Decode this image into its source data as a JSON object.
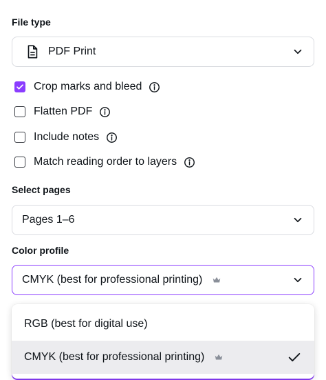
{
  "file_type": {
    "label": "File type",
    "value": "PDF Print",
    "icon": "file-document-icon"
  },
  "options": [
    {
      "label": "Crop marks and bleed",
      "checked": true
    },
    {
      "label": "Flatten PDF",
      "checked": false
    },
    {
      "label": "Include notes",
      "checked": false
    },
    {
      "label": "Match reading order to layers",
      "checked": false
    }
  ],
  "select_pages": {
    "label": "Select pages",
    "value": "Pages 1–6"
  },
  "color_profile": {
    "label": "Color profile",
    "value": "CMYK (best for professional printing)",
    "menu": [
      {
        "label": "RGB (best for digital use)",
        "premium": false,
        "selected": false
      },
      {
        "label": "CMYK (best for professional printing)",
        "premium": true,
        "selected": true
      }
    ]
  },
  "colors": {
    "accent": "#8b3dff",
    "text": "#0e1318",
    "border": "#d9dbe0",
    "selected_bg": "#ececef"
  }
}
